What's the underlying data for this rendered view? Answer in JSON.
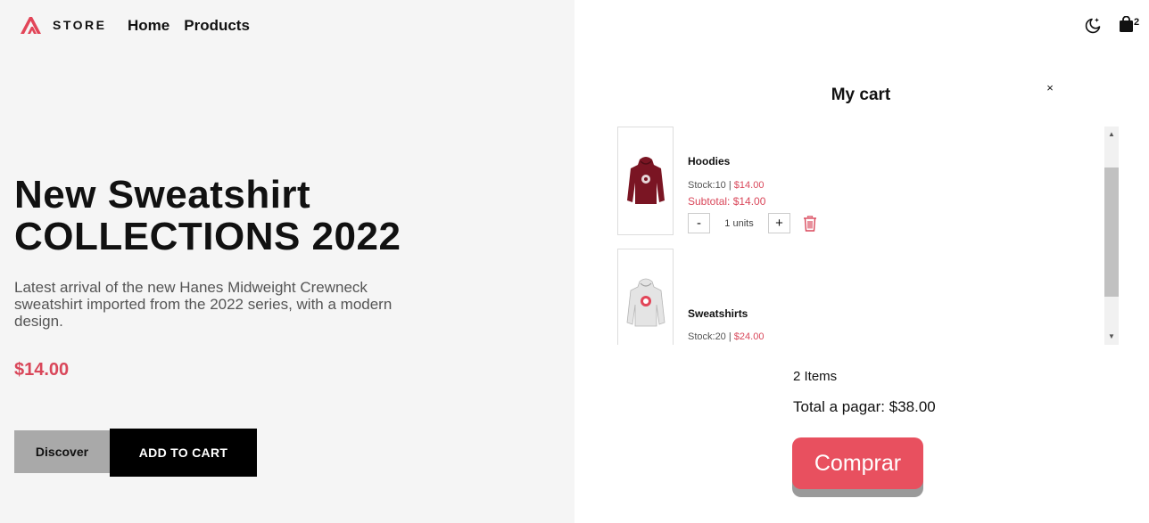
{
  "header": {
    "logo_text": "STORE",
    "nav": [
      "Home",
      "Products"
    ],
    "cart_count": "2",
    "icons": [
      "store-logo-icon",
      "moon-icon",
      "shopping-bag-icon"
    ]
  },
  "hero": {
    "title_line1": "New Sweatshirt",
    "title_line2": "COLLECTIONS 2022",
    "description": "Latest arrival of the new Hanes Midweight Crewneck sweatshirt imported from the 2022 series, with a modern design.",
    "price": "$14.00",
    "discover_label": "Discover",
    "add_to_cart_label": "ADD TO CART"
  },
  "cart": {
    "title": "My cart",
    "close_label": "×",
    "items": [
      {
        "name": "Hoodies",
        "stock_label": "Stock:10",
        "separator": "|",
        "price": "$14.00",
        "subtotal": "Subtotal: $14.00",
        "units": "1 units",
        "minus": "-",
        "plus": "+",
        "image": "maroon-hoodie"
      },
      {
        "name": "Sweatshirts",
        "stock_label": "Stock:20",
        "separator": "|",
        "price": "$24.00",
        "image": "white-hoodie"
      }
    ],
    "items_count": "2 Items",
    "total": "Total a pagar: $38.00",
    "buy_label": "Comprar"
  },
  "colors": {
    "accent": "#d9475a",
    "buy_button": "#e8505f",
    "left_background": "#f5f5f5"
  }
}
